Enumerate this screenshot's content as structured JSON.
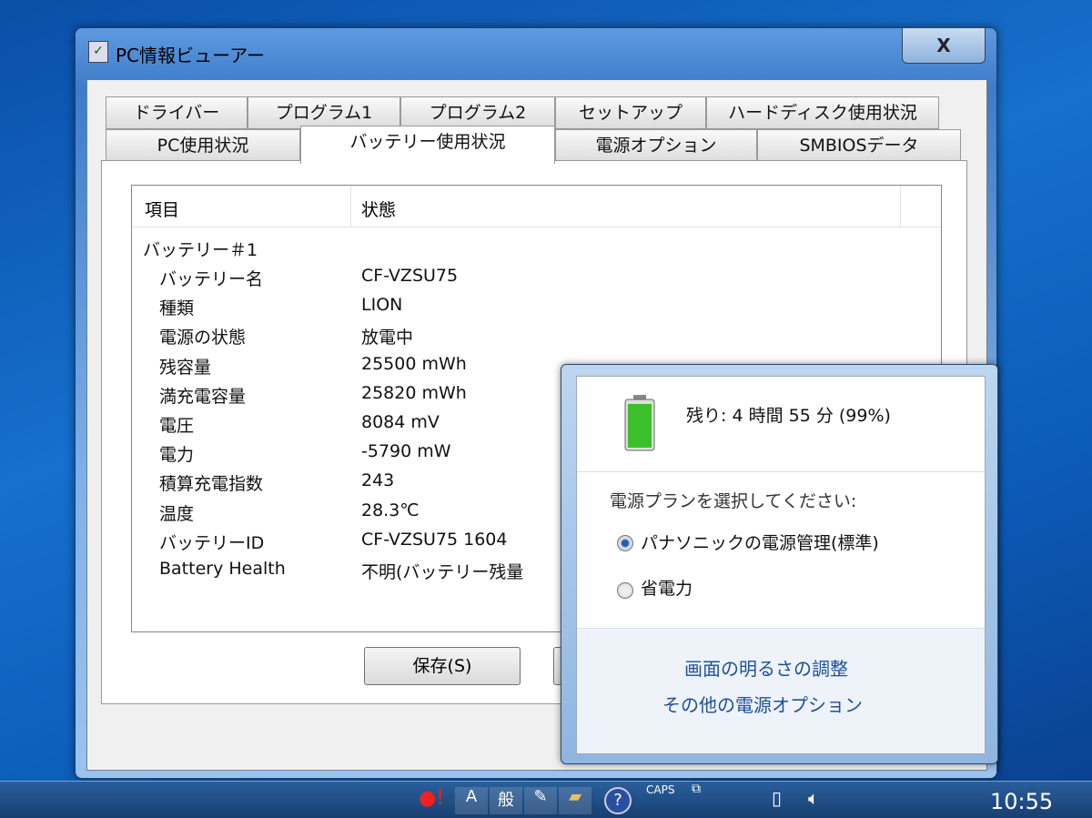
{
  "window": {
    "title": "PC情報ビューアー",
    "close_label": "X"
  },
  "tabs_row1": [
    "ドライバー",
    "プログラム1",
    "プログラム2",
    "セットアップ",
    "ハードディスク使用状況"
  ],
  "tabs_row2": [
    "PC使用状況",
    "バッテリー使用状況",
    "電源オプション",
    "SMBIOSデータ"
  ],
  "list": {
    "headers": [
      "項目",
      "状態"
    ],
    "group": "バッテリー＃1",
    "rows": [
      [
        "バッテリー名",
        "CF-VZSU75"
      ],
      [
        "種類",
        "LION"
      ],
      [
        "電源の状態",
        "放電中"
      ],
      [
        "残容量",
        "25500 mWh"
      ],
      [
        "満充電容量",
        "25820 mWh"
      ],
      [
        "電圧",
        "8084 mV"
      ],
      [
        "電力",
        "-5790 mW"
      ],
      [
        "積算充電指数",
        "243"
      ],
      [
        "温度",
        "28.3℃"
      ],
      [
        "バッテリーID",
        "CF-VZSU75     1604"
      ],
      [
        "Battery Health",
        "不明(バッテリー残量"
      ]
    ]
  },
  "buttons": {
    "save": "保存(S)"
  },
  "popup": {
    "remaining": "残り: 4 時間 55 分 (99%)",
    "plan_prompt": "電源プランを選択してください:",
    "plans": [
      "パナソニックの電源管理(標準)",
      "省電力"
    ],
    "links": [
      "画面の明るさの調整",
      "その他の電源オプション"
    ]
  },
  "taskbar": {
    "caps": "CAPS",
    "clock": "10:55"
  }
}
